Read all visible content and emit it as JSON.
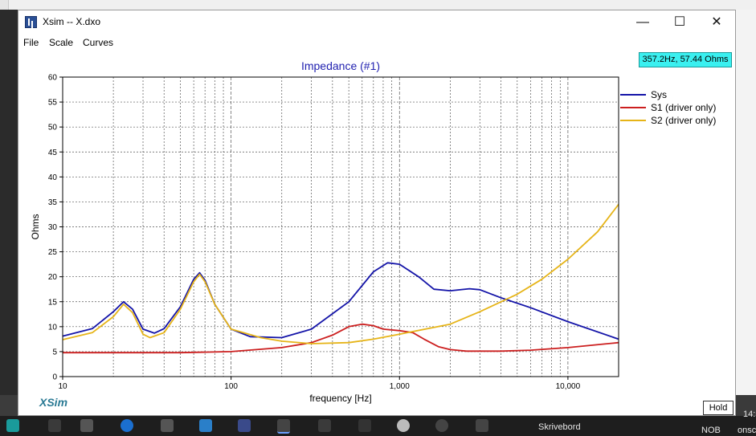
{
  "window": {
    "title": "Xsim -- X.dxo",
    "controls": {
      "minimize": "—",
      "maximize": "☐",
      "close": "✕"
    }
  },
  "menu": [
    "File",
    "Scale",
    "Curves"
  ],
  "readout": "357.2Hz, 57.44 Ohms",
  "logo": "XSim",
  "hold_label": "Hold",
  "colors": {
    "sys": "#1414a8",
    "s1": "#cc1f1f",
    "s2": "#e6b418",
    "title": "#2222b0",
    "readout_bg": "#3af0f0"
  },
  "chart_data": {
    "type": "line",
    "title": "Impedance (#1)",
    "xlabel": "frequency [Hz]",
    "ylabel": "Ohms",
    "x_scale": "log",
    "xlim": [
      10,
      20000
    ],
    "ylim": [
      0,
      60
    ],
    "grid": true,
    "legend": "right",
    "x_tick_labels": [
      {
        "value": 10,
        "label": "10"
      },
      {
        "value": 100,
        "label": "100"
      },
      {
        "value": 1000,
        "label": "1,000"
      },
      {
        "value": 10000,
        "label": "10,000"
      }
    ],
    "y_ticks": [
      0,
      5,
      10,
      15,
      20,
      25,
      30,
      35,
      40,
      45,
      50,
      55,
      60
    ],
    "series": [
      {
        "name": "Sys",
        "key": "sys",
        "points": [
          [
            10,
            8.1
          ],
          [
            15,
            9.6
          ],
          [
            20,
            13.0
          ],
          [
            23,
            15.0
          ],
          [
            26,
            13.5
          ],
          [
            30,
            9.5
          ],
          [
            35,
            8.7
          ],
          [
            40,
            9.6
          ],
          [
            50,
            14.0
          ],
          [
            60,
            19.5
          ],
          [
            65,
            20.8
          ],
          [
            70,
            19.3
          ],
          [
            80,
            14.5
          ],
          [
            100,
            9.5
          ],
          [
            130,
            8.0
          ],
          [
            200,
            7.8
          ],
          [
            300,
            9.5
          ],
          [
            500,
            15.0
          ],
          [
            700,
            21.0
          ],
          [
            850,
            22.8
          ],
          [
            1000,
            22.5
          ],
          [
            1300,
            20.0
          ],
          [
            1600,
            17.5
          ],
          [
            2000,
            17.2
          ],
          [
            2600,
            17.6
          ],
          [
            3000,
            17.4
          ],
          [
            4000,
            15.8
          ],
          [
            6000,
            13.8
          ],
          [
            10000,
            11.0
          ],
          [
            20000,
            7.5
          ]
        ]
      },
      {
        "name": "S1 (driver only)",
        "key": "s1",
        "points": [
          [
            10,
            4.8
          ],
          [
            50,
            4.8
          ],
          [
            100,
            5.0
          ],
          [
            200,
            5.8
          ],
          [
            300,
            6.8
          ],
          [
            400,
            8.3
          ],
          [
            500,
            10.0
          ],
          [
            600,
            10.5
          ],
          [
            700,
            10.2
          ],
          [
            800,
            9.5
          ],
          [
            1000,
            9.2
          ],
          [
            1200,
            8.8
          ],
          [
            1400,
            7.5
          ],
          [
            1700,
            6.0
          ],
          [
            2000,
            5.4
          ],
          [
            2500,
            5.1
          ],
          [
            4000,
            5.1
          ],
          [
            6000,
            5.3
          ],
          [
            10000,
            5.8
          ],
          [
            20000,
            6.8
          ]
        ]
      },
      {
        "name": "S2 (driver only)",
        "key": "s2",
        "points": [
          [
            10,
            7.4
          ],
          [
            15,
            8.8
          ],
          [
            20,
            12.0
          ],
          [
            23,
            14.5
          ],
          [
            26,
            12.8
          ],
          [
            30,
            8.5
          ],
          [
            33,
            7.8
          ],
          [
            40,
            8.8
          ],
          [
            50,
            13.5
          ],
          [
            60,
            19.0
          ],
          [
            65,
            20.5
          ],
          [
            70,
            19.0
          ],
          [
            80,
            14.5
          ],
          [
            100,
            9.5
          ],
          [
            150,
            7.8
          ],
          [
            200,
            7.1
          ],
          [
            300,
            6.6
          ],
          [
            500,
            6.8
          ],
          [
            700,
            7.5
          ],
          [
            1000,
            8.5
          ],
          [
            2000,
            10.5
          ],
          [
            3000,
            13.0
          ],
          [
            5000,
            16.5
          ],
          [
            7000,
            19.5
          ],
          [
            10000,
            23.5
          ],
          [
            15000,
            29.0
          ],
          [
            20000,
            34.5
          ]
        ]
      }
    ]
  }
}
